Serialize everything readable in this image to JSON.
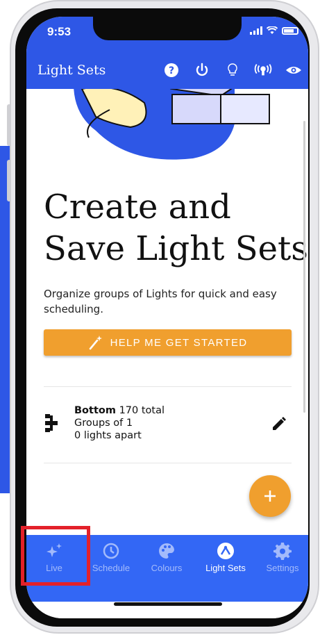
{
  "status_bar": {
    "time": "9:53"
  },
  "app_bar": {
    "title": "Light Sets",
    "icons": [
      "help-icon",
      "power-icon",
      "bulb-icon",
      "broadcast-icon",
      "eye-icon"
    ]
  },
  "main": {
    "headline_line1": "Create and",
    "headline_line2": "Save Light Sets",
    "description": "Organize groups of Lights for quick and easy scheduling.",
    "help_button_label": "HELP ME GET STARTED"
  },
  "light_set": {
    "name": "Bottom",
    "total": "170 total",
    "groups": "Groups of 1",
    "spacing": "0 lights apart"
  },
  "fab": {
    "icon": "plus-icon"
  },
  "bottom_nav": {
    "items": [
      {
        "label": "Live",
        "icon": "sparkles-icon",
        "active": false
      },
      {
        "label": "Schedule",
        "icon": "clock-icon",
        "active": false
      },
      {
        "label": "Colours",
        "icon": "palette-icon",
        "active": false
      },
      {
        "label": "Light Sets",
        "icon": "light-sets-icon",
        "active": true
      },
      {
        "label": "Settings",
        "icon": "gear-icon",
        "active": false
      }
    ]
  },
  "colors": {
    "primary": "#2e57e6",
    "nav": "#3367f5",
    "accent": "#f09f2e",
    "highlight": "#e3212a"
  }
}
